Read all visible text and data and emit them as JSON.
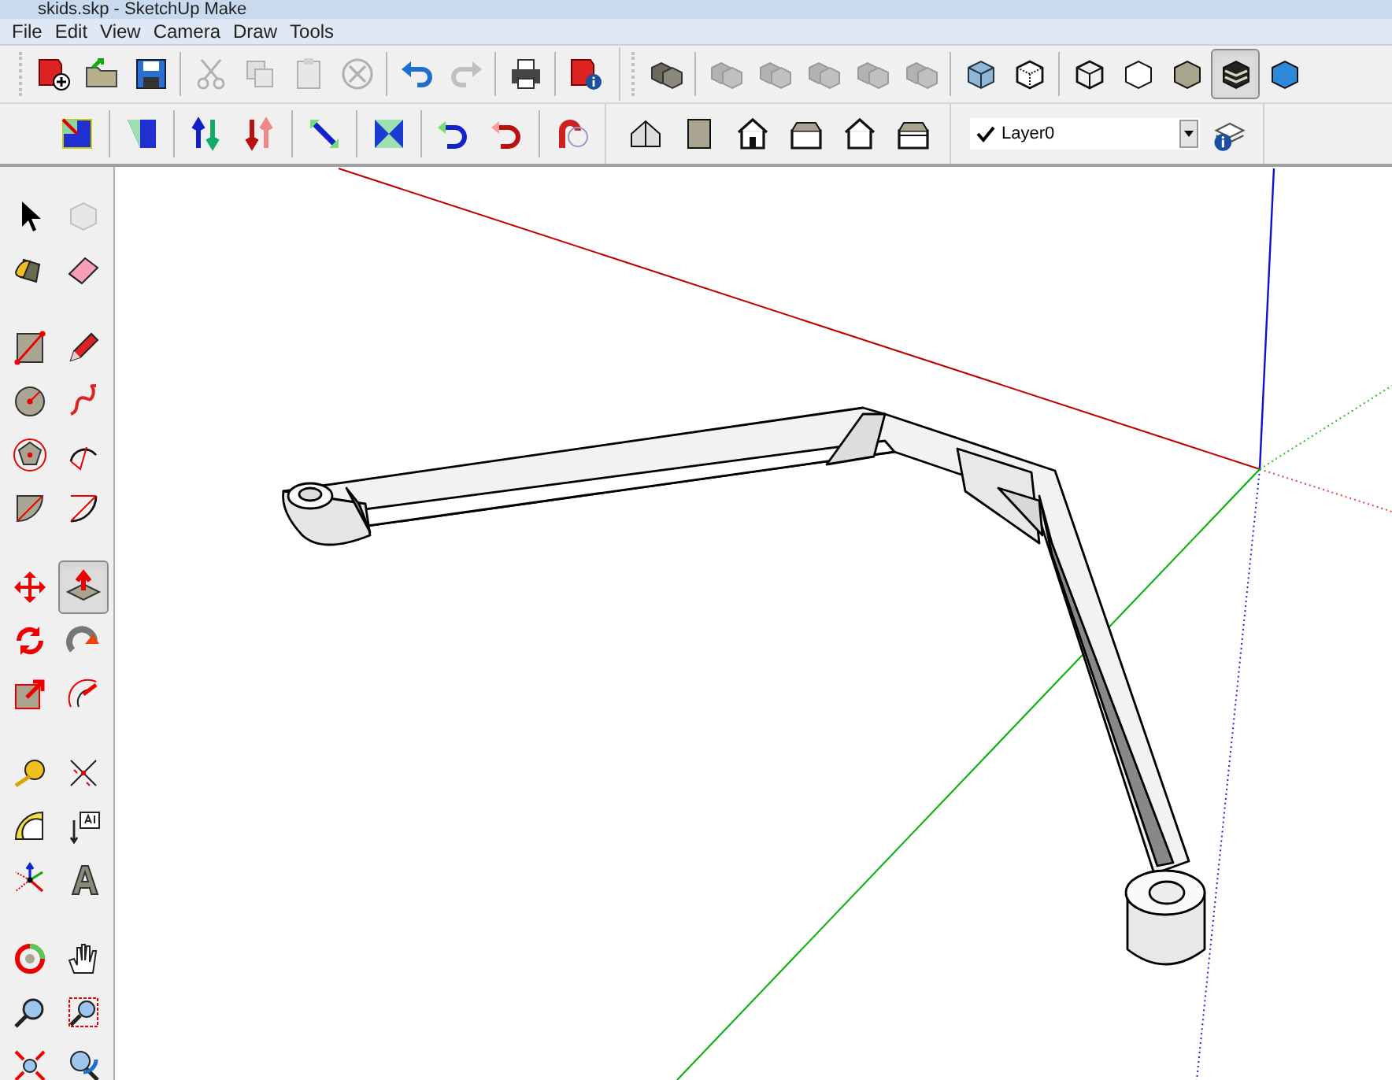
{
  "window": {
    "title": "skids.skp - SketchUp Make"
  },
  "menu": [
    {
      "label": "File"
    },
    {
      "label": "Edit"
    },
    {
      "label": "View"
    },
    {
      "label": "Camera"
    },
    {
      "label": "Draw"
    },
    {
      "label": "Tools"
    }
  ],
  "top_toolbar": [
    [
      {
        "kind": "new",
        "disabled": false,
        "selected": false
      },
      {
        "kind": "open",
        "disabled": false,
        "selected": false
      },
      {
        "kind": "save",
        "disabled": false,
        "selected": false
      }
    ],
    [
      {
        "kind": "cut",
        "disabled": true,
        "selected": false
      },
      {
        "kind": "copy",
        "disabled": true,
        "selected": false
      },
      {
        "kind": "paste",
        "disabled": true,
        "selected": false
      },
      {
        "kind": "erase",
        "disabled": true,
        "selected": false
      }
    ],
    [
      {
        "kind": "undo",
        "disabled": false,
        "selected": false
      },
      {
        "kind": "redo",
        "disabled": true,
        "selected": false
      }
    ],
    [
      {
        "kind": "print",
        "disabled": false,
        "selected": false
      }
    ],
    [
      {
        "kind": "info",
        "disabled": false,
        "selected": false
      }
    ],
    [
      {
        "kind": "components",
        "disabled": false,
        "selected": false
      }
    ],
    [
      {
        "kind": "components",
        "disabled": true,
        "selected": false
      },
      {
        "kind": "components",
        "disabled": true,
        "selected": false
      },
      {
        "kind": "components",
        "disabled": true,
        "selected": false
      },
      {
        "kind": "components",
        "disabled": true,
        "selected": false
      },
      {
        "kind": "components",
        "disabled": true,
        "selected": false
      }
    ],
    [
      {
        "kind": "xray",
        "disabled": false,
        "selected": false
      },
      {
        "kind": "backedges",
        "disabled": false,
        "selected": false
      }
    ],
    [
      {
        "kind": "wireframe",
        "disabled": false,
        "selected": false
      },
      {
        "kind": "hiddenline",
        "disabled": false,
        "selected": false
      },
      {
        "kind": "shaded",
        "disabled": false,
        "selected": false
      },
      {
        "kind": "textured",
        "disabled": false,
        "selected": true
      },
      {
        "kind": "monochrome",
        "disabled": false,
        "selected": false
      }
    ]
  ],
  "second_toolbar": [
    [
      {
        "kind": "section",
        "disabled": false,
        "selected": false
      }
    ],
    [
      {
        "kind": "face",
        "disabled": false,
        "selected": false
      }
    ],
    [
      {
        "kind": "flipblue",
        "disabled": false,
        "selected": false
      },
      {
        "kind": "flipred",
        "disabled": false,
        "selected": false
      }
    ],
    [
      {
        "kind": "diagonal",
        "disabled": false,
        "selected": false
      }
    ],
    [
      {
        "kind": "hourglass",
        "disabled": false,
        "selected": false
      }
    ],
    [
      {
        "kind": "turnblue",
        "disabled": false,
        "selected": false
      },
      {
        "kind": "turnred",
        "disabled": false,
        "selected": false
      }
    ],
    [
      {
        "kind": "bendred",
        "disabled": false,
        "selected": false
      }
    ]
  ],
  "views_toolbar": [
    {
      "kind": "iso",
      "disabled": false,
      "selected": false
    },
    {
      "kind": "top",
      "disabled": false,
      "selected": false
    },
    {
      "kind": "front",
      "disabled": false,
      "selected": false
    },
    {
      "kind": "right",
      "disabled": false,
      "selected": false
    },
    {
      "kind": "back",
      "disabled": false,
      "selected": false
    },
    {
      "kind": "left",
      "disabled": false,
      "selected": false
    }
  ],
  "layer": {
    "name": "Layer0",
    "current": true
  },
  "left_toolbar": [
    [
      [
        {
          "kind": "select",
          "disabled": false,
          "selected": false
        },
        {
          "kind": "component",
          "disabled": true,
          "selected": false
        }
      ],
      [
        {
          "kind": "paint",
          "disabled": false,
          "selected": false
        },
        {
          "kind": "eraser",
          "disabled": false,
          "selected": false
        }
      ]
    ],
    [
      [
        {
          "kind": "rectangle",
          "disabled": false,
          "selected": false
        },
        {
          "kind": "line",
          "disabled": false,
          "selected": false
        }
      ],
      [
        {
          "kind": "circle",
          "disabled": false,
          "selected": false
        },
        {
          "kind": "freehand",
          "disabled": false,
          "selected": false
        }
      ],
      [
        {
          "kind": "polygon",
          "disabled": false,
          "selected": false
        },
        {
          "kind": "arc",
          "disabled": false,
          "selected": false
        }
      ],
      [
        {
          "kind": "pie",
          "disabled": false,
          "selected": false
        },
        {
          "kind": "arc2",
          "disabled": false,
          "selected": false
        }
      ]
    ],
    [
      [
        {
          "kind": "move",
          "disabled": false,
          "selected": false
        },
        {
          "kind": "pushpull",
          "disabled": false,
          "selected": true
        }
      ],
      [
        {
          "kind": "rotate",
          "disabled": false,
          "selected": false
        },
        {
          "kind": "followme",
          "disabled": false,
          "selected": false
        }
      ],
      [
        {
          "kind": "scale",
          "disabled": false,
          "selected": false
        },
        {
          "kind": "offset",
          "disabled": false,
          "selected": false
        }
      ]
    ],
    [
      [
        {
          "kind": "tape",
          "disabled": false,
          "selected": false
        },
        {
          "kind": "dimension",
          "disabled": false,
          "selected": false
        }
      ],
      [
        {
          "kind": "protractor",
          "disabled": false,
          "selected": false
        },
        {
          "kind": "text",
          "disabled": false,
          "selected": false
        }
      ],
      [
        {
          "kind": "axes",
          "disabled": false,
          "selected": false
        },
        {
          "kind": "text3d",
          "disabled": false,
          "selected": false
        }
      ]
    ],
    [
      [
        {
          "kind": "orbit",
          "disabled": false,
          "selected": false
        },
        {
          "kind": "pan",
          "disabled": false,
          "selected": false
        }
      ],
      [
        {
          "kind": "zoom",
          "disabled": false,
          "selected": false
        },
        {
          "kind": "zoomwindow",
          "disabled": false,
          "selected": false
        }
      ],
      [
        {
          "kind": "zoomextents",
          "disabled": false,
          "selected": false
        },
        {
          "kind": "previous",
          "disabled": false,
          "selected": false
        }
      ]
    ]
  ]
}
